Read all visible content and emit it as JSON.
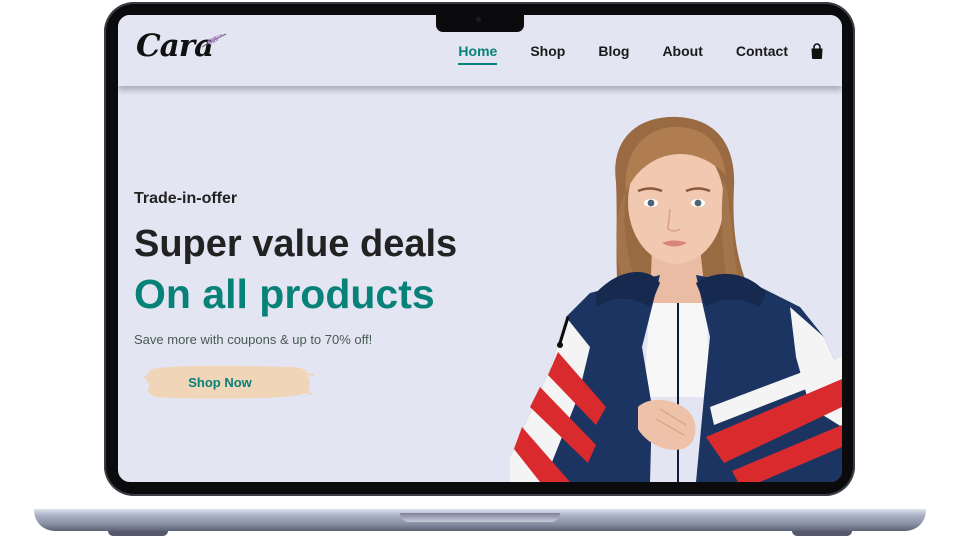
{
  "brand": {
    "logo_text": "Cara"
  },
  "nav": {
    "items": [
      {
        "label": "Home",
        "active": true
      },
      {
        "label": "Shop",
        "active": false
      },
      {
        "label": "Blog",
        "active": false
      },
      {
        "label": "About",
        "active": false
      },
      {
        "label": "Contact",
        "active": false
      }
    ],
    "cart_icon": "shopping-bag-icon"
  },
  "hero": {
    "eyebrow": "Trade-in-offer",
    "headline": "Super value deals",
    "headline_accent": "On all products",
    "subtext": "Save more with coupons & up to 70% off!",
    "cta_label": "Shop Now",
    "image": "model-in-track-jacket"
  },
  "colors": {
    "accent": "#088178",
    "background": "#e4e5f3",
    "cta_brush": "#f0d5b8",
    "jacket_navy": "#1c3461",
    "jacket_red": "#d92b2e"
  }
}
